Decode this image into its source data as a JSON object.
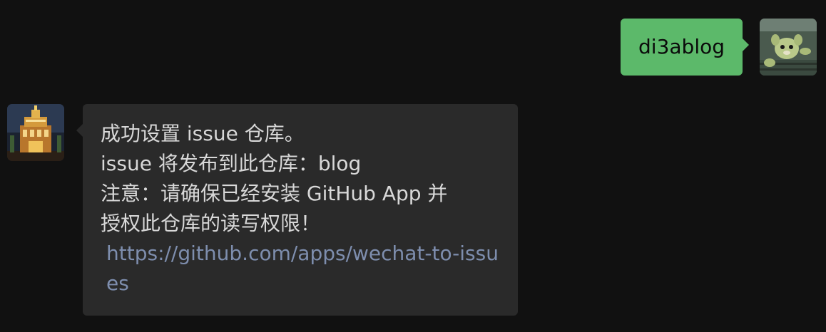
{
  "outgoing": {
    "text": "di3ablog",
    "avatar_icon": "plush-toy-avatar-icon"
  },
  "incoming": {
    "avatar_icon": "lit-building-avatar-icon",
    "lines": [
      "成功设置 issue 仓库。",
      "issue 将发布到此仓库：blog",
      "注意：请确保已经安装 GitHub App 并",
      "授权此仓库的读写权限！"
    ],
    "link": "https://github.com/apps/wechat-to-issues"
  },
  "colors": {
    "background": "#111111",
    "outgoing_bubble": "#5cb96a",
    "incoming_bubble": "#2a2a2a",
    "incoming_text": "#d8d8d8",
    "link": "#7e8eae"
  }
}
